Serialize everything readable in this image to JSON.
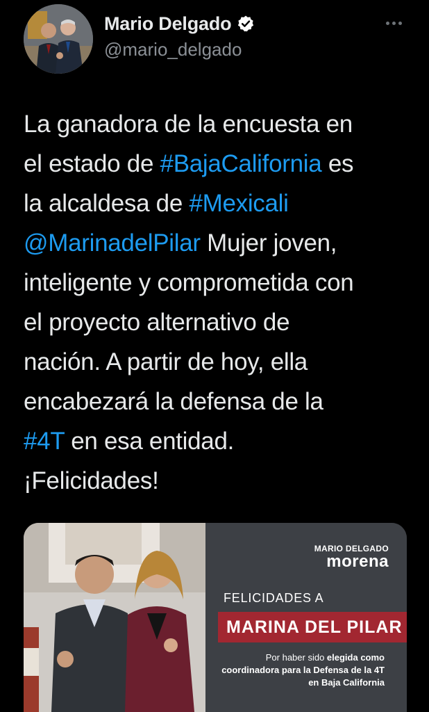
{
  "author": {
    "display_name": "Mario Delgado",
    "handle": "@mario_delgado",
    "verified": true,
    "avatar_icon": "avatar-photo"
  },
  "more_icon": "more-horizontal-icon",
  "tweet": {
    "lines": [
      [
        {
          "t": "La ganadora de la encuesta en"
        }
      ],
      [
        {
          "t": "el estado de "
        },
        {
          "t": "#BajaCalifornia",
          "link": true
        },
        {
          "t": " es"
        }
      ],
      [
        {
          "t": "la alcaldesa de "
        },
        {
          "t": "#Mexicali",
          "link": true
        }
      ],
      [
        {
          "t": "@MarinadelPilar",
          "link": true
        },
        {
          "t": " Mujer joven,"
        }
      ],
      [
        {
          "t": "inteligente y comprometida con"
        }
      ],
      [
        {
          "t": "el proyecto alternativo de"
        }
      ],
      [
        {
          "t": "nación. A partir de hoy, ella"
        }
      ],
      [
        {
          "t": "encabezará la defensa de la"
        }
      ],
      [
        {
          "t": "#4T",
          "link": true
        },
        {
          "t": " en esa entidad."
        }
      ],
      [
        {
          "t": "¡Felicidades!"
        }
      ]
    ]
  },
  "media": {
    "brand_top": "MARIO DELGADO",
    "brand_main": "morena",
    "greeting": "FELICIDADES A",
    "banner_name": "MARINA DEL PILAR",
    "caption_pre": "Por haber sido ",
    "caption_bold_1": "elegida como",
    "caption_bold_2": "coordinadora para la Defensa de la 4T en Baja California"
  },
  "colors": {
    "background": "#000000",
    "text": "#e7e9ea",
    "secondary": "#8b9096",
    "link": "#1d9bf0",
    "banner": "#a22731",
    "media_panel": "#3d4045"
  }
}
